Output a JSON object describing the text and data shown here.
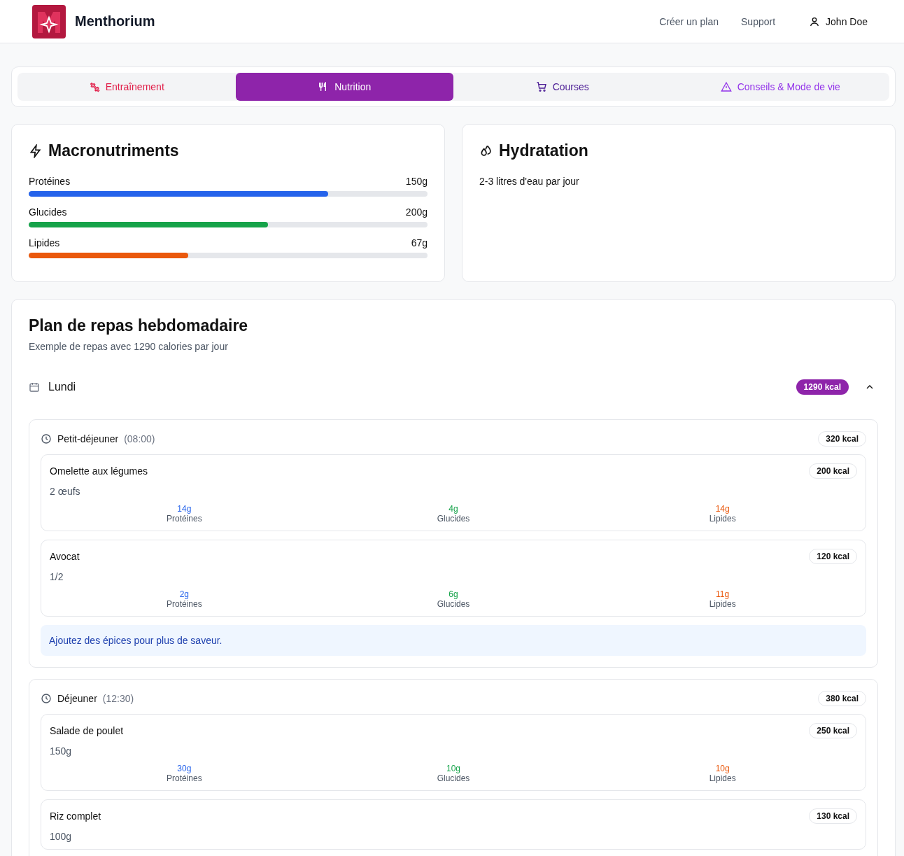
{
  "header": {
    "brand": "Menthorium",
    "nav": [
      "Créer un plan",
      "Support"
    ],
    "user": "John Doe"
  },
  "tabs": [
    {
      "label": "Entraînement",
      "kind": "dumbbell",
      "selected": false,
      "color": "#e11d48"
    },
    {
      "label": "Nutrition",
      "kind": "utensils",
      "selected": true
    },
    {
      "label": "Courses",
      "kind": "cart",
      "selected": false,
      "color": "#4c1d95"
    },
    {
      "label": "Conseils & Mode de vie",
      "kind": "warning",
      "selected": false,
      "color": "#9333ea"
    }
  ],
  "macros": {
    "title": "Macronutriments",
    "items": [
      {
        "name": "Protéines",
        "amount": "150g",
        "level": 0.75,
        "color": "#2563eb"
      },
      {
        "name": "Glucides",
        "amount": "200g",
        "level": 0.6,
        "color": "#16a34a"
      },
      {
        "name": "Lipides",
        "amount": "67g",
        "level": 0.4,
        "color": "#ea580c"
      }
    ]
  },
  "hydration": {
    "title": "Hydratation",
    "text": "2-3 litres d'eau par jour"
  },
  "plan": {
    "title": "Plan de repas hebdomadaire",
    "subtitle": "Exemple de repas avec 1290 calories par jour",
    "days": [
      {
        "name": "Lundi",
        "kcal": "1290 kcal",
        "expanded": true,
        "meals": [
          {
            "name": "Petit-déjeuner",
            "time": "(08:00)",
            "kcal": "320 kcal",
            "tip": "Ajoutez des épices pour plus de saveur.",
            "foods": [
              {
                "name": "Omelette aux légumes",
                "kcal": "200 kcal",
                "qty": "2 œufs",
                "macros": [
                  {
                    "value": "14g",
                    "label": "Protéines",
                    "color": "#2563eb"
                  },
                  {
                    "value": "4g",
                    "label": "Glucides",
                    "color": "#16a34a"
                  },
                  {
                    "value": "14g",
                    "label": "Lipides",
                    "color": "#ea580c"
                  }
                ]
              },
              {
                "name": "Avocat",
                "kcal": "120 kcal",
                "qty": "1/2",
                "macros": [
                  {
                    "value": "2g",
                    "label": "Protéines",
                    "color": "#2563eb"
                  },
                  {
                    "value": "6g",
                    "label": "Glucides",
                    "color": "#16a34a"
                  },
                  {
                    "value": "11g",
                    "label": "Lipides",
                    "color": "#ea580c"
                  }
                ]
              }
            ]
          },
          {
            "name": "Déjeuner",
            "time": "(12:30)",
            "kcal": "380 kcal",
            "foods": [
              {
                "name": "Salade de poulet",
                "kcal": "250 kcal",
                "qty": "150g",
                "macros": [
                  {
                    "value": "30g",
                    "label": "Protéines",
                    "color": "#2563eb"
                  },
                  {
                    "value": "10g",
                    "label": "Glucides",
                    "color": "#16a34a"
                  },
                  {
                    "value": "10g",
                    "label": "Lipides",
                    "color": "#ea580c"
                  }
                ]
              },
              {
                "name": "Riz complet",
                "kcal": "130 kcal",
                "qty": "100g"
              }
            ]
          }
        ]
      }
    ]
  }
}
